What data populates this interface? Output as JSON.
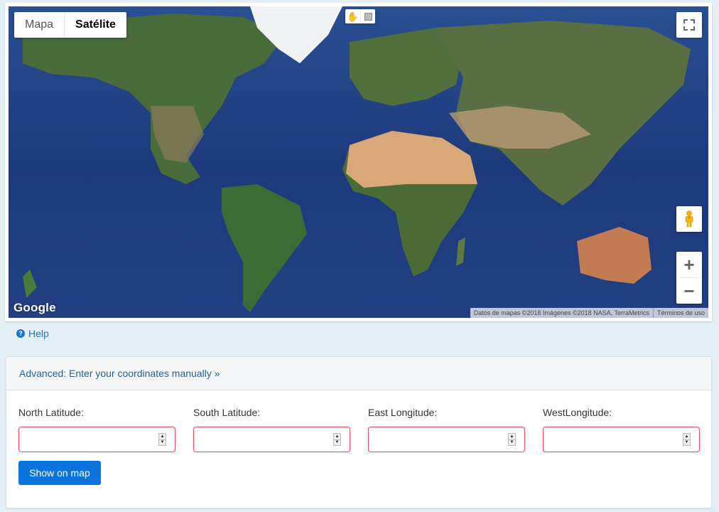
{
  "map": {
    "map_type_options": [
      {
        "label": "Mapa",
        "active": false
      },
      {
        "label": "Satélite",
        "active": true
      }
    ],
    "draw_tools": [
      {
        "icon": "hand-pan-icon",
        "glyph": "✋"
      },
      {
        "icon": "rectangle-draw-icon"
      }
    ],
    "fullscreen_icon": "fullscreen-icon",
    "street_view_icon": "pegman-icon",
    "zoom_in_label": "+",
    "zoom_out_label": "−",
    "logo": "Google",
    "attribution": "Datos de mapas ©2018 Imágenes ©2018 NASA, TerraMetrics",
    "terms_link": "Términos de uso"
  },
  "help": {
    "icon": "question-circle-icon",
    "icon_glyph": "?",
    "label": "Help"
  },
  "panel": {
    "header_link": "Advanced: Enter your coordinates manually »",
    "fields": [
      {
        "label": "North Latitude:",
        "value": "",
        "placeholder": ""
      },
      {
        "label": "South Latitude:",
        "value": "",
        "placeholder": ""
      },
      {
        "label": "East Longitude:",
        "value": "",
        "placeholder": ""
      },
      {
        "label": "WestLongitude:",
        "value": "",
        "placeholder": ""
      }
    ],
    "spinner_up": "▲",
    "spinner_down": "▼",
    "submit_label": "Show on map"
  },
  "colors": {
    "accent": "#0a73dc",
    "link": "#1b5f9d",
    "invalid_border": "#e8525b",
    "page_bg": "#e3eef5"
  }
}
